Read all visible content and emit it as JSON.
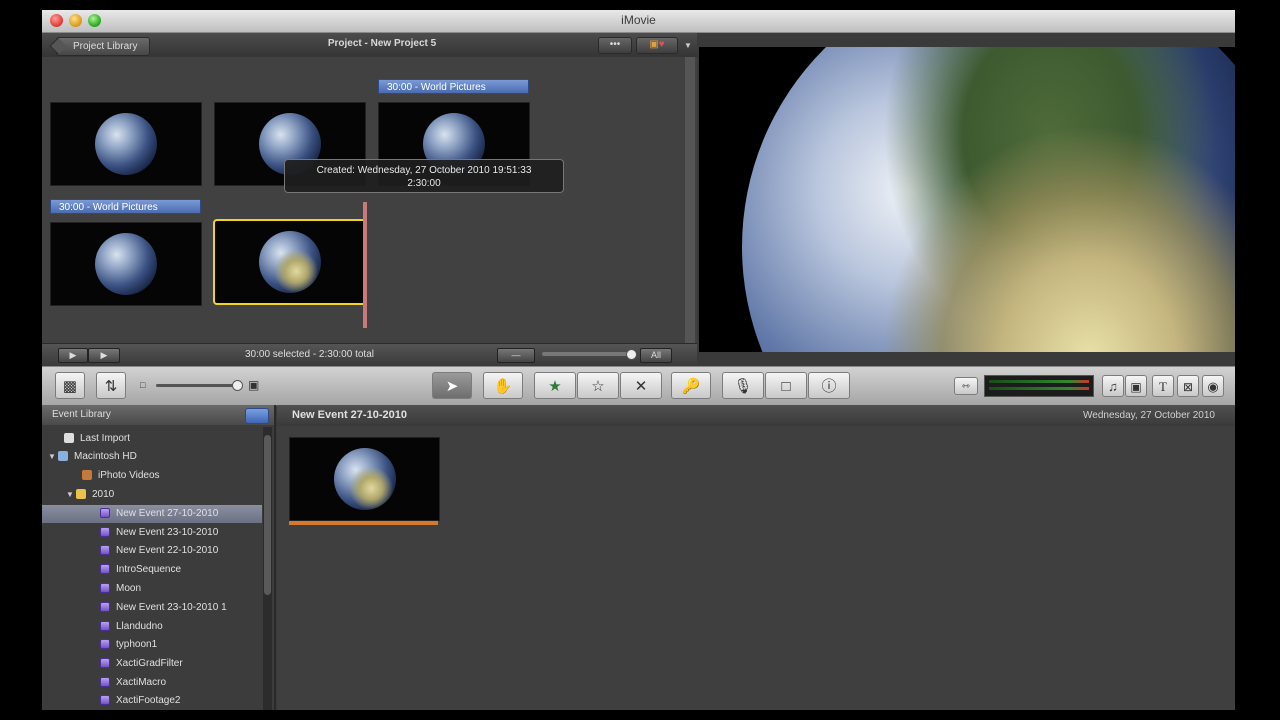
{
  "window": {
    "title": "iMovie"
  },
  "project": {
    "back_label": "Project Library",
    "title": "Project - New Project 5",
    "more_label": "•••",
    "title_bar_1": "30:00 - World Pictures",
    "title_bar_2": "30:00 - World Pictures",
    "tooltip_line1": "Created: Wednesday, 27 October 2010 19:51:33",
    "tooltip_line2": "2:30:00",
    "footer_status": "30:00 selected - 2:30:00 total",
    "all_label": "All"
  },
  "toolbar": {
    "selected_tool": "arrow"
  },
  "event_library": {
    "header": "Event Library",
    "items": [
      {
        "label": "Last Import"
      },
      {
        "label": "Macintosh HD"
      },
      {
        "label": "iPhoto Videos"
      },
      {
        "label": "2010"
      },
      {
        "label": "New Event 27-10-2010"
      },
      {
        "label": "New Event 23-10-2010"
      },
      {
        "label": "New Event 22-10-2010"
      },
      {
        "label": "IntroSequence"
      },
      {
        "label": "Moon"
      },
      {
        "label": "New Event 23-10-2010 1"
      },
      {
        "label": "Llandudno"
      },
      {
        "label": "typhoon1"
      },
      {
        "label": "XactiGradFilter"
      },
      {
        "label": "XactiMacro"
      },
      {
        "label": "XactiFootage2"
      }
    ]
  },
  "event_browser": {
    "title": "New Event 27-10-2010",
    "date": "Wednesday, 27 October 2010"
  },
  "colors": {
    "selection_border": "#f1d41c",
    "title_bar_blue": "#5a7bc0",
    "event_bar": "#d47a2a"
  }
}
